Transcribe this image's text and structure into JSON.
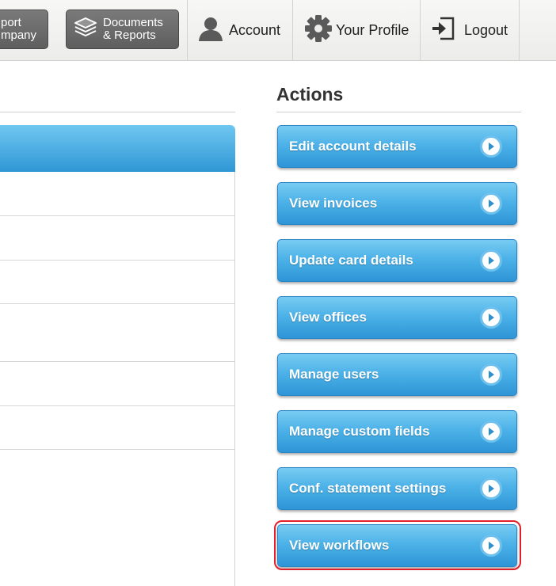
{
  "topbar": {
    "import_button": {
      "line1": "port",
      "line2": "mpany"
    },
    "docs_button": {
      "line1": "Documents",
      "line2": "& Reports"
    },
    "account_label": "Account",
    "profile_label": "Your Profile",
    "logout_label": "Logout"
  },
  "actions": {
    "title": "Actions",
    "items": [
      {
        "label": "Edit account details"
      },
      {
        "label": "View invoices"
      },
      {
        "label": "Update card details"
      },
      {
        "label": "View offices"
      },
      {
        "label": "Manage users"
      },
      {
        "label": "Manage custom fields"
      },
      {
        "label": "Conf. statement settings"
      },
      {
        "label": "View workflows"
      }
    ]
  },
  "colors": {
    "button_blue": "#3fa6e0",
    "highlight_red": "#e0202a"
  }
}
